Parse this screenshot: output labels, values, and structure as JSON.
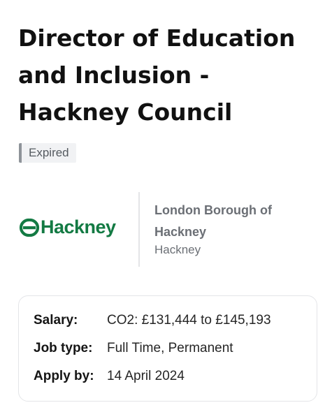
{
  "job": {
    "title": "Director of Education and Inclusion - Hackney Council",
    "status": "Expired"
  },
  "employer": {
    "logo_text": "Hackney",
    "logo_icon": "hackney-arrows-logo-icon",
    "name": "London Borough of Hackney",
    "location": "Hackney"
  },
  "details": [
    {
      "label": "Salary:",
      "value": "CO2: £131,444 to £145,193"
    },
    {
      "label": "Job type:",
      "value": "Full Time, Permanent"
    },
    {
      "label": "Apply by:",
      "value": "14 April 2024"
    }
  ],
  "colors": {
    "brand_green": "#137a43",
    "badge_bar": "#8e9399",
    "muted_text": "#6b6f75"
  }
}
